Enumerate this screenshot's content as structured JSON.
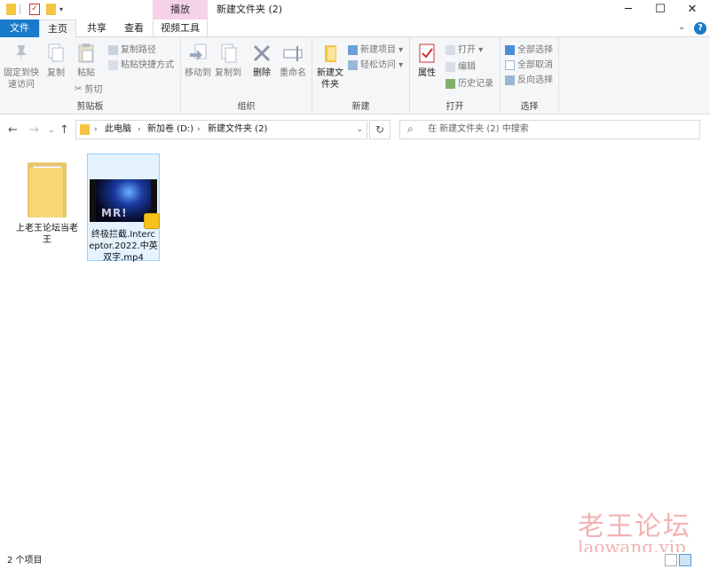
{
  "titlebar": {
    "context_tab": "播放",
    "title": "新建文件夹 (2)",
    "minimize": "─",
    "maximize": "☐",
    "close": "✕"
  },
  "tabs": [
    {
      "label": "文件"
    },
    {
      "label": "主页"
    },
    {
      "label": "共享"
    },
    {
      "label": "查看"
    },
    {
      "label": "视频工具"
    }
  ],
  "ribbon": {
    "clipboard": {
      "label": "剪贴板",
      "pin": "固定到快速访问",
      "copy": "复制",
      "paste": "粘贴",
      "copy_path": "复制路径",
      "paste_shortcut": "粘贴快捷方式",
      "cut": "剪切"
    },
    "organize": {
      "label": "组织",
      "move_to": "移动到",
      "copy_to": "复制到",
      "delete": "删除",
      "rename": "重命名"
    },
    "new": {
      "label": "新建",
      "new_folder": "新建文件夹",
      "new_item": "新建项目",
      "easy_access": "轻松访问"
    },
    "open": {
      "label": "打开",
      "properties": "属性",
      "open": "打开",
      "edit": "编辑",
      "history": "历史记录"
    },
    "select": {
      "label": "选择",
      "select_all": "全部选择",
      "select_none": "全部取消",
      "invert": "反向选择"
    }
  },
  "address": {
    "crumbs": [
      "此电脑",
      "新加卷 (D:)",
      "新建文件夹 (2)"
    ],
    "search_placeholder": "在 新建文件夹 (2) 中搜索"
  },
  "items": [
    {
      "name": "上老王论坛当老王",
      "type": "folder"
    },
    {
      "name": "终极拦截.Interceptor.2022.中英双字.mp4",
      "type": "video",
      "thumb_text": "MR!"
    }
  ],
  "watermark": {
    "cn": "老王论坛",
    "en": "laowang.vip"
  },
  "status": {
    "count": "2 个项目"
  },
  "colors": {
    "accent": "#1979ca",
    "context_tab": "#f6d1ea",
    "selection": "#e5f3ff",
    "folder": "#f7d675",
    "watermark": "#f2b3b3"
  }
}
